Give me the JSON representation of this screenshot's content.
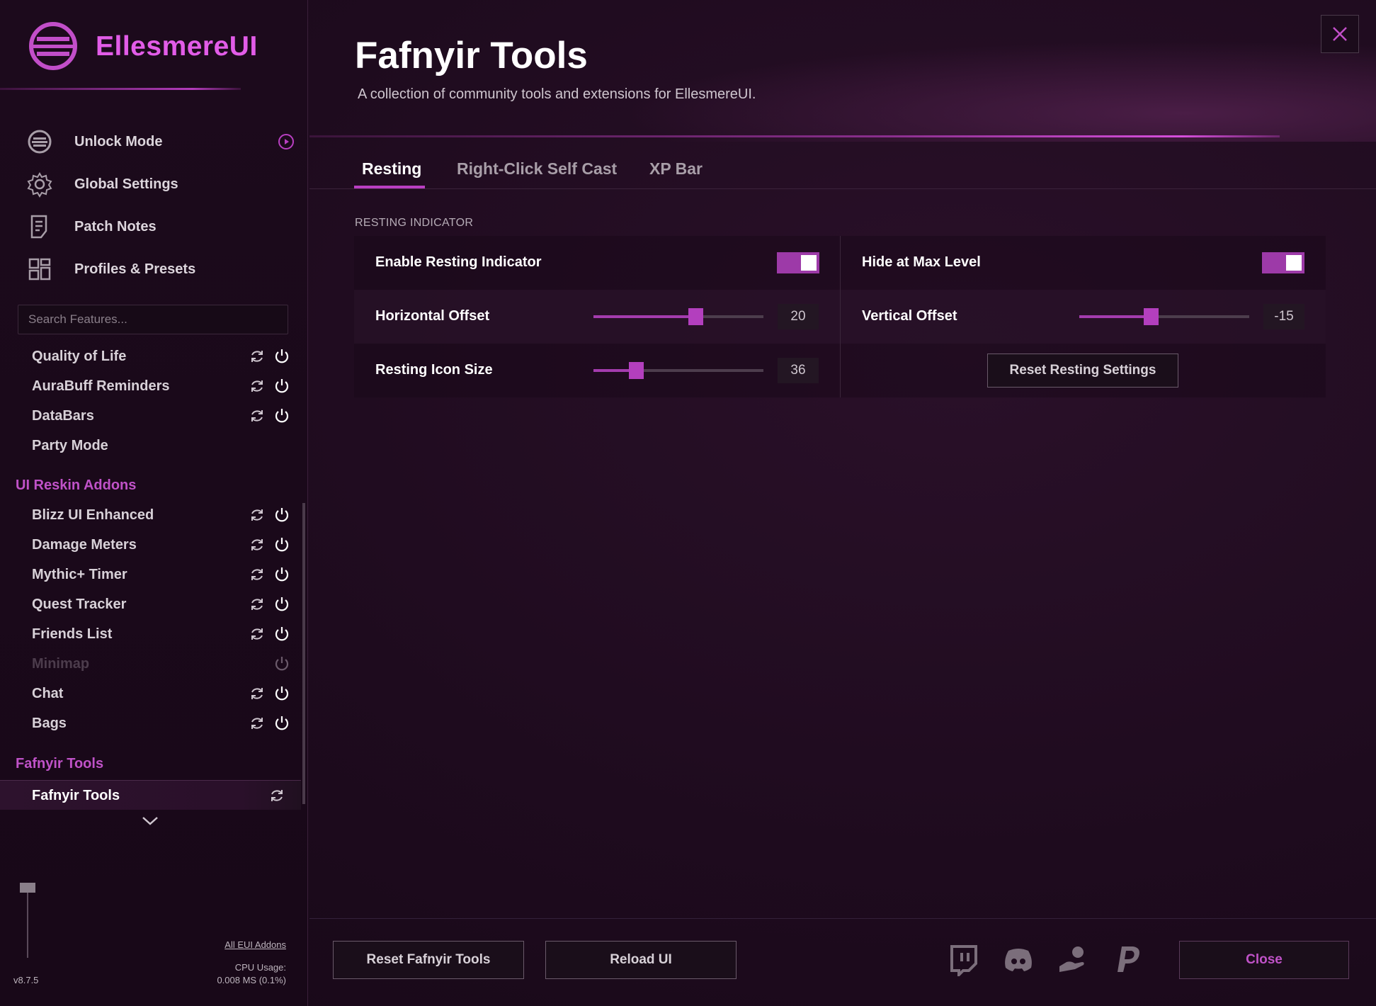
{
  "sidebar": {
    "logo_text": "EllesmereUI",
    "nav": [
      {
        "label": "Unlock Mode",
        "icon": "unlock-mode-icon"
      },
      {
        "label": "Global Settings",
        "icon": "gear-icon"
      },
      {
        "label": "Patch Notes",
        "icon": "document-icon"
      },
      {
        "label": "Profiles & Presets",
        "icon": "grid-icon"
      }
    ],
    "search_placeholder": "Search Features...",
    "features": [
      {
        "label": "Quality of Life"
      },
      {
        "label": "AuraBuff Reminders"
      },
      {
        "label": "DataBars"
      },
      {
        "label": "Party Mode"
      }
    ],
    "section_reskin": "UI Reskin Addons",
    "reskin": [
      {
        "label": "Blizz UI Enhanced"
      },
      {
        "label": "Damage Meters"
      },
      {
        "label": "Mythic+ Timer"
      },
      {
        "label": "Quest Tracker"
      },
      {
        "label": "Friends List"
      },
      {
        "label": "Minimap",
        "disabled": true
      },
      {
        "label": "Chat"
      },
      {
        "label": "Bags"
      }
    ],
    "section_fafnyir": "Fafnyir Tools",
    "active_item": "Fafnyir Tools",
    "all_addons_label": "All EUI Addons",
    "cpu_label": "CPU Usage:",
    "cpu_value": "0.008 MS (0.1%)",
    "version": "v8.7.5"
  },
  "header": {
    "title": "Fafnyir Tools",
    "subtitle": "A collection of community tools and extensions for EllesmereUI."
  },
  "tabs": [
    "Resting",
    "Right-Click Self Cast",
    "XP Bar"
  ],
  "active_tab": "Resting",
  "section_label": "RESTING INDICATOR",
  "settings": {
    "enable_resting_label": "Enable Resting Indicator",
    "enable_resting_on": true,
    "hide_max_label": "Hide at Max Level",
    "hide_max_on": true,
    "h_offset_label": "Horizontal Offset",
    "h_offset_value": "20",
    "h_offset_fraction": 0.6,
    "v_offset_label": "Vertical Offset",
    "v_offset_value": "-15",
    "v_offset_fraction": 0.42,
    "icon_size_label": "Resting Icon Size",
    "icon_size_value": "36",
    "icon_size_fraction": 0.25,
    "reset_resting_label": "Reset Resting Settings"
  },
  "footer": {
    "reset_label": "Reset Fafnyir Tools",
    "reload_label": "Reload UI",
    "close_label": "Close",
    "social": [
      "twitch-icon",
      "discord-icon",
      "donate-hand-icon",
      "paypal-icon"
    ]
  },
  "colors": {
    "accent": "#b93fc2",
    "logo": "#e25ce8",
    "section": "#c052c8",
    "close_text": "#c052c8"
  }
}
